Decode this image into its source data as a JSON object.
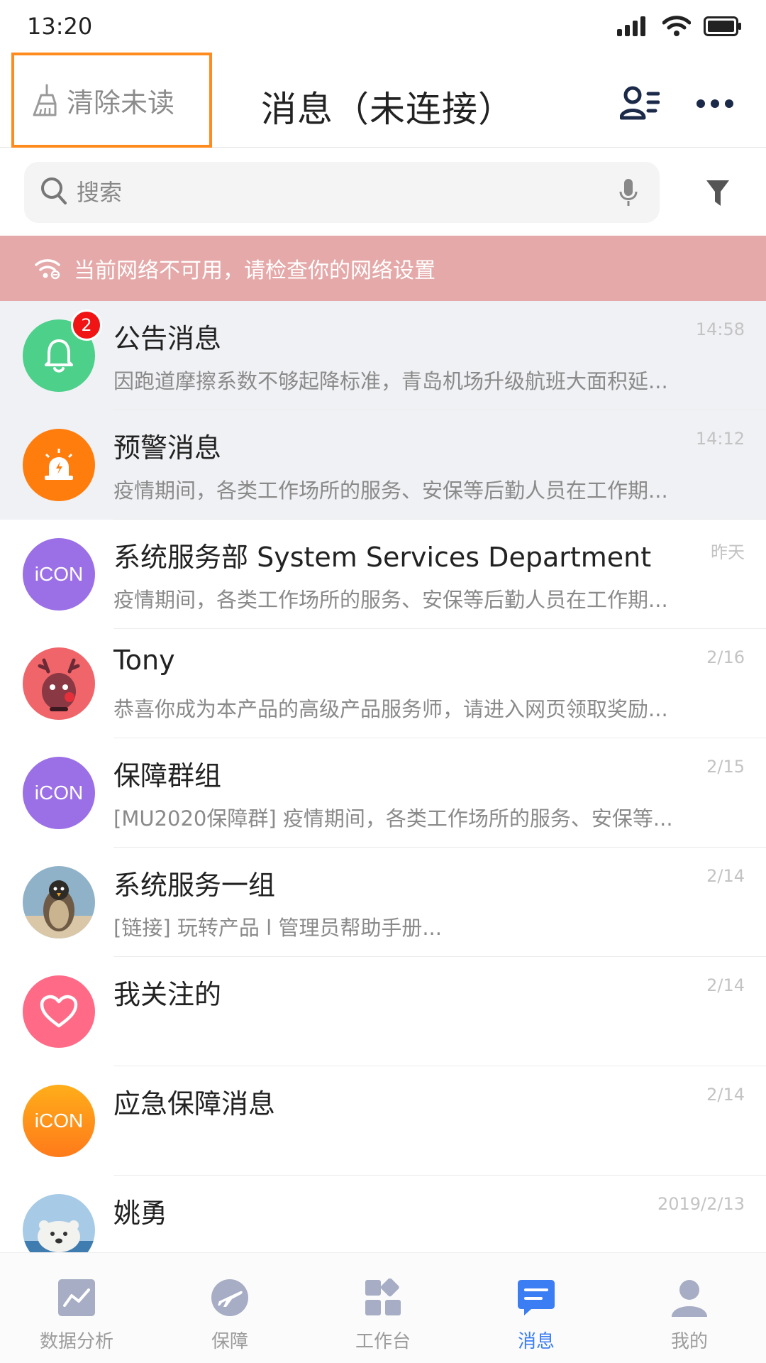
{
  "status_bar": {
    "time": "13:20",
    "signal_icon": "signal-icon",
    "wifi_icon": "wifi-icon",
    "battery_icon": "battery-icon"
  },
  "nav": {
    "clear_unread_label": "清除未读",
    "clear_unread_icon": "broom-icon",
    "title": "消息（未连接）",
    "contacts_icon": "contacts-icon",
    "more_icon": "more-icon",
    "highlight_color": "#ff8a1e"
  },
  "search": {
    "placeholder": "搜索",
    "value": "",
    "search_icon": "search-icon",
    "mic_icon": "mic-icon",
    "filter_icon": "filter-icon"
  },
  "network_banner": {
    "text": "当前网络不可用，请检查你的网络设置",
    "icon": "wifi-off-icon",
    "color": "#e5a9a9"
  },
  "conversations": [
    {
      "name": "公告消息",
      "preview": "因跑道摩擦系数不够起降标准，青岛机场升级航班大面积延...",
      "time": "14:58",
      "badge": "2",
      "avatar": "bell-icon",
      "avatar_color": "#4cd08a",
      "pinned": true
    },
    {
      "name": "预警消息",
      "preview": "疫情期间，各类工作场所的服务、安保等后勤人员在工作期...",
      "time": "14:12",
      "avatar": "alarm-icon",
      "avatar_color": "#ff7d0d",
      "pinned": true
    },
    {
      "name": "系统服务部 System Services Department",
      "preview": "疫情期间，各类工作场所的服务、安保等后勤人员在工作期...",
      "time": "昨天",
      "avatar_text": "iCON",
      "avatar_color": "#9b70e6"
    },
    {
      "name": "Tony",
      "preview": "恭喜你成为本产品的高级产品服务师，请进入网页领取奖励...",
      "time": "2/16",
      "avatar": "reindeer-avatar",
      "avatar_color": "#f0656a"
    },
    {
      "name": "保障群组",
      "preview": "[MU2020保障群] 疫情期间，各类工作场所的服务、安保等...",
      "time": "2/15",
      "avatar_text": "iCON",
      "avatar_color": "#9b70e6"
    },
    {
      "name": "系统服务一组",
      "preview": "[链接] 玩转产品 l 管理员帮助手册...",
      "time": "2/14",
      "avatar": "penguin-avatar",
      "avatar_color": "#8fb2c9"
    },
    {
      "name": "我关注的",
      "preview": "",
      "time": "2/14",
      "avatar": "heart-icon",
      "avatar_color": "#ff6b86"
    },
    {
      "name": "应急保障消息",
      "preview": "",
      "time": "2/14",
      "avatar_text": "iCON",
      "avatar_color": "#ff8c1a"
    },
    {
      "name": "姚勇",
      "preview": "",
      "time": "2019/2/13",
      "avatar": "polar-bear-avatar",
      "avatar_color": "#a7cbe6"
    }
  ],
  "tabs": [
    {
      "label": "数据分析",
      "icon": "chart-icon",
      "active": false
    },
    {
      "label": "保障",
      "icon": "plane-icon",
      "active": false
    },
    {
      "label": "工作台",
      "icon": "grid-icon",
      "active": false
    },
    {
      "label": "消息",
      "icon": "message-icon",
      "active": true
    },
    {
      "label": "我的",
      "icon": "user-icon",
      "active": false
    }
  ],
  "colors": {
    "accent": "#3b7df2",
    "inactive_tab": "#9c9c9c"
  }
}
